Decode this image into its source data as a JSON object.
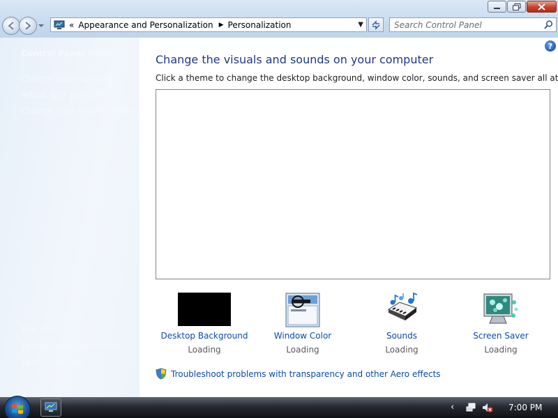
{
  "window": {
    "minimize_label": "Minimize",
    "maximize_label": "Maximize",
    "close_label": "Close"
  },
  "address": {
    "overflow_chevron": "«",
    "crumbs": [
      "Appearance and Personalization",
      "Personalization"
    ]
  },
  "search": {
    "placeholder": "Search Control Panel"
  },
  "sidebar": {
    "home": "Control Panel Home",
    "links": [
      "Change desktop icons",
      "Adjust font size (DPI)",
      "Change your mouse pointers"
    ],
    "see_also_title": "See also",
    "see_also": [
      "Taskbar and Start Menu",
      "Ease of Access"
    ]
  },
  "main": {
    "title": "Change the visuals and sounds on your computer",
    "description": "Click a theme to change the desktop background, window color, sounds, and screen saver all at once.",
    "tiles": [
      {
        "label": "Desktop Background",
        "status": "Loading",
        "icon": "desktop-background-icon"
      },
      {
        "label": "Window Color",
        "status": "Loading",
        "icon": "window-color-icon"
      },
      {
        "label": "Sounds",
        "status": "Loading",
        "icon": "sounds-icon"
      },
      {
        "label": "Screen Saver",
        "status": "Loading",
        "icon": "screen-saver-icon"
      }
    ],
    "troubleshoot": "Troubleshoot problems with transparency and other Aero effects"
  },
  "taskbar": {
    "clock": "7:00 PM"
  },
  "colors": {
    "link": "#0a4ba8",
    "title": "#1c3a87"
  }
}
